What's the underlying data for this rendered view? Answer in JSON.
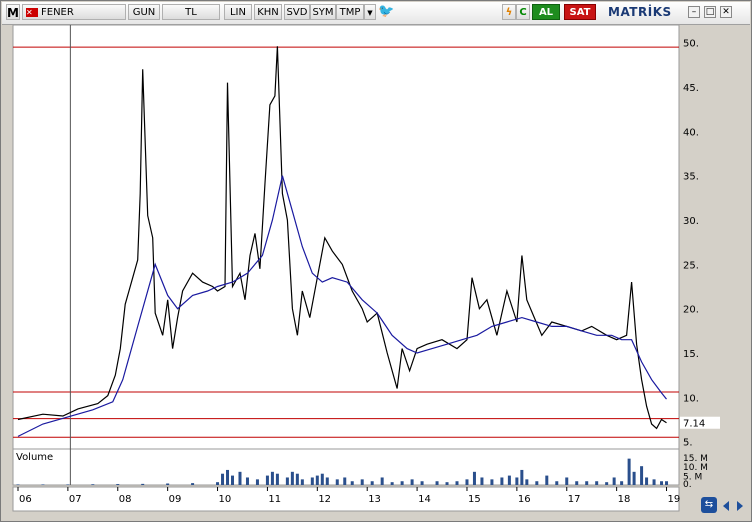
{
  "toolbar": {
    "logo": "M",
    "symbol": "FENER",
    "buttons": [
      "GUN",
      "TL",
      "LIN",
      "KHN",
      "SVD",
      "SYM",
      "TMP"
    ],
    "buy_label": "AL",
    "sell_label": "SAT",
    "brand": "MATRİKS"
  },
  "icons": {
    "dropdown": "triangle-down-icon",
    "twitter": "twitter-icon",
    "bolt": "lightning-icon",
    "refresh": "refresh-icon",
    "minimize": "minimize-icon",
    "maximize": "maximize-icon",
    "close": "close-icon",
    "scroll": "scroll-sync-icon"
  },
  "colors": {
    "price": "#000000",
    "moving_average": "#1a1aa0",
    "level_lines": "#c00000",
    "volume": "#2a4f8c",
    "current_marker": "#1a1aa0"
  },
  "chart_data": {
    "type": "line",
    "x_tick_labels": [
      "06",
      "07",
      "08",
      "09",
      "10",
      "11",
      "12",
      "13",
      "14",
      "15",
      "16",
      "17",
      "18",
      "19"
    ],
    "x_ticks": [
      2006,
      2007,
      2008,
      2009,
      2010,
      2011,
      2012,
      2013,
      2014,
      2015,
      2016,
      2017,
      2018,
      2019
    ],
    "xlim": [
      2005.9,
      2019.25
    ],
    "y_tick_labels": [
      "50.",
      "45.",
      "40.",
      "35.",
      "30.",
      "25.",
      "20.",
      "15.",
      "10.",
      "5."
    ],
    "y_ticks": [
      50,
      45,
      40,
      35,
      30,
      25,
      20,
      15,
      10,
      5
    ],
    "ylim": [
      3.5,
      52
    ],
    "current_value_label": "7.14",
    "current_value": 7.14,
    "horizontal_lines": [
      49.5,
      10.6,
      7.6,
      5.5
    ],
    "vertical_line_x": 2007.05,
    "series": [
      {
        "points": [
          [
            2006.0,
            7.5
          ],
          [
            2006.5,
            8.1
          ],
          [
            2006.9,
            7.9
          ],
          [
            2007.2,
            8.7
          ],
          [
            2007.6,
            9.3
          ],
          [
            2007.8,
            10.2
          ],
          [
            2007.95,
            12.5
          ],
          [
            2008.05,
            15.5
          ],
          [
            2008.15,
            20.5
          ],
          [
            2008.3,
            23.5
          ],
          [
            2008.4,
            25.5
          ],
          [
            2008.45,
            33
          ],
          [
            2008.5,
            47
          ],
          [
            2008.6,
            30.5
          ],
          [
            2008.7,
            28
          ],
          [
            2008.75,
            19.5
          ],
          [
            2008.9,
            17
          ],
          [
            2009.0,
            21
          ],
          [
            2009.1,
            15.5
          ],
          [
            2009.2,
            19
          ],
          [
            2009.3,
            22
          ],
          [
            2009.5,
            24
          ],
          [
            2009.7,
            23
          ],
          [
            2009.9,
            22.5
          ],
          [
            2010.0,
            22
          ],
          [
            2010.15,
            22.5
          ],
          [
            2010.2,
            45.5
          ],
          [
            2010.3,
            22.5
          ],
          [
            2010.45,
            24
          ],
          [
            2010.55,
            21
          ],
          [
            2010.65,
            26
          ],
          [
            2010.75,
            28.5
          ],
          [
            2010.85,
            24.5
          ],
          [
            2010.95,
            34
          ],
          [
            2011.05,
            43
          ],
          [
            2011.15,
            44
          ],
          [
            2011.2,
            49.6
          ],
          [
            2011.3,
            33
          ],
          [
            2011.4,
            30
          ],
          [
            2011.5,
            20
          ],
          [
            2011.6,
            17
          ],
          [
            2011.7,
            22
          ],
          [
            2011.85,
            19
          ],
          [
            2012.0,
            23.5
          ],
          [
            2012.15,
            28
          ],
          [
            2012.3,
            26.5
          ],
          [
            2012.5,
            25
          ],
          [
            2012.7,
            22
          ],
          [
            2012.9,
            20
          ],
          [
            2013.0,
            18.5
          ],
          [
            2013.2,
            19.5
          ],
          [
            2013.4,
            15
          ],
          [
            2013.6,
            11
          ],
          [
            2013.7,
            15.5
          ],
          [
            2013.85,
            13
          ],
          [
            2014.0,
            15.5
          ],
          [
            2014.2,
            16
          ],
          [
            2014.5,
            16.5
          ],
          [
            2014.8,
            15.5
          ],
          [
            2015.0,
            16.5
          ],
          [
            2015.1,
            23.5
          ],
          [
            2015.25,
            20
          ],
          [
            2015.4,
            21
          ],
          [
            2015.6,
            17
          ],
          [
            2015.8,
            22
          ],
          [
            2016.0,
            18.5
          ],
          [
            2016.1,
            26
          ],
          [
            2016.2,
            21
          ],
          [
            2016.35,
            19
          ],
          [
            2016.5,
            17
          ],
          [
            2016.7,
            18.5
          ],
          [
            2017.0,
            18
          ],
          [
            2017.3,
            17.5
          ],
          [
            2017.5,
            18
          ],
          [
            2017.8,
            17
          ],
          [
            2018.0,
            16.5
          ],
          [
            2018.2,
            17
          ],
          [
            2018.3,
            23
          ],
          [
            2018.4,
            16
          ],
          [
            2018.5,
            12
          ],
          [
            2018.6,
            9
          ],
          [
            2018.7,
            7
          ],
          [
            2018.8,
            6.5
          ],
          [
            2018.9,
            7.5
          ],
          [
            2019.0,
            7.14
          ]
        ]
      },
      {
        "points": [
          [
            2006.0,
            5.6
          ],
          [
            2006.5,
            7
          ],
          [
            2007.0,
            7.8
          ],
          [
            2007.5,
            8.6
          ],
          [
            2007.9,
            9.5
          ],
          [
            2008.1,
            12
          ],
          [
            2008.4,
            18
          ],
          [
            2008.75,
            25
          ],
          [
            2009.0,
            21.5
          ],
          [
            2009.2,
            20
          ],
          [
            2009.5,
            21.5
          ],
          [
            2009.8,
            22
          ],
          [
            2010.0,
            22.5
          ],
          [
            2010.3,
            23
          ],
          [
            2010.6,
            24
          ],
          [
            2010.9,
            26
          ],
          [
            2011.1,
            30
          ],
          [
            2011.3,
            35
          ],
          [
            2011.5,
            31
          ],
          [
            2011.7,
            27
          ],
          [
            2011.9,
            24
          ],
          [
            2012.1,
            23
          ],
          [
            2012.3,
            23.5
          ],
          [
            2012.6,
            23
          ],
          [
            2012.9,
            21
          ],
          [
            2013.2,
            19.5
          ],
          [
            2013.5,
            17
          ],
          [
            2013.8,
            15.5
          ],
          [
            2014.0,
            15
          ],
          [
            2014.3,
            15.5
          ],
          [
            2014.6,
            16
          ],
          [
            2014.9,
            16.5
          ],
          [
            2015.2,
            17
          ],
          [
            2015.5,
            18
          ],
          [
            2015.8,
            18.5
          ],
          [
            2016.1,
            19
          ],
          [
            2016.4,
            18.5
          ],
          [
            2016.7,
            18
          ],
          [
            2017.0,
            18
          ],
          [
            2017.3,
            17.5
          ],
          [
            2017.6,
            17
          ],
          [
            2017.9,
            17
          ],
          [
            2018.1,
            16.5
          ],
          [
            2018.3,
            16.5
          ],
          [
            2018.5,
            14
          ],
          [
            2018.7,
            12
          ],
          [
            2018.9,
            10.5
          ],
          [
            2019.0,
            9.8
          ]
        ]
      }
    ],
    "volume": {
      "label": "Volume",
      "y_tick_labels": [
        "15. M",
        "10. M",
        "5. M",
        "0."
      ],
      "y_ticks": [
        15,
        10,
        5,
        0
      ],
      "ylim": [
        0,
        17
      ],
      "points": [
        [
          2006.0,
          0.3
        ],
        [
          2006.5,
          0.3
        ],
        [
          2007.0,
          0.3
        ],
        [
          2007.5,
          0.4
        ],
        [
          2008.0,
          0.5
        ],
        [
          2008.5,
          0.6
        ],
        [
          2009.0,
          0.8
        ],
        [
          2009.5,
          1
        ],
        [
          2010.0,
          1.5
        ],
        [
          2010.1,
          6
        ],
        [
          2010.2,
          8
        ],
        [
          2010.3,
          5
        ],
        [
          2010.45,
          7
        ],
        [
          2010.6,
          4
        ],
        [
          2010.8,
          3
        ],
        [
          2011.0,
          5
        ],
        [
          2011.1,
          7
        ],
        [
          2011.2,
          6
        ],
        [
          2011.4,
          4
        ],
        [
          2011.5,
          7
        ],
        [
          2011.6,
          6
        ],
        [
          2011.7,
          3
        ],
        [
          2011.9,
          4
        ],
        [
          2012.0,
          5
        ],
        [
          2012.1,
          6
        ],
        [
          2012.2,
          4
        ],
        [
          2012.4,
          3
        ],
        [
          2012.55,
          4
        ],
        [
          2012.7,
          2
        ],
        [
          2012.9,
          3
        ],
        [
          2013.1,
          2
        ],
        [
          2013.3,
          4
        ],
        [
          2013.5,
          1.5
        ],
        [
          2013.7,
          2
        ],
        [
          2013.9,
          3
        ],
        [
          2014.1,
          2
        ],
        [
          2014.4,
          2
        ],
        [
          2014.6,
          1.5
        ],
        [
          2014.8,
          2
        ],
        [
          2015.0,
          3
        ],
        [
          2015.15,
          7
        ],
        [
          2015.3,
          4
        ],
        [
          2015.5,
          3
        ],
        [
          2015.7,
          4
        ],
        [
          2015.85,
          5
        ],
        [
          2016.0,
          4
        ],
        [
          2016.1,
          8
        ],
        [
          2016.2,
          3
        ],
        [
          2016.4,
          2
        ],
        [
          2016.6,
          5
        ],
        [
          2016.8,
          2
        ],
        [
          2017.0,
          4
        ],
        [
          2017.2,
          2
        ],
        [
          2017.4,
          2
        ],
        [
          2017.6,
          2
        ],
        [
          2017.8,
          1.5
        ],
        [
          2017.95,
          4
        ],
        [
          2018.1,
          2
        ],
        [
          2018.25,
          14
        ],
        [
          2018.35,
          7
        ],
        [
          2018.5,
          10
        ],
        [
          2018.6,
          4
        ],
        [
          2018.75,
          3
        ],
        [
          2018.9,
          2
        ],
        [
          2019.0,
          2
        ]
      ]
    }
  }
}
